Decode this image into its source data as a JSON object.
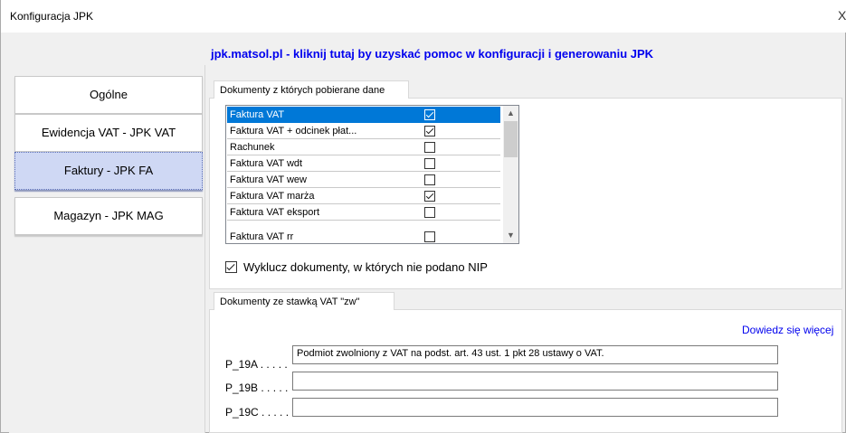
{
  "window": {
    "title": "Konfiguracja JPK",
    "close_glyph": "X"
  },
  "help_link": "jpk.matsol.pl - kliknij tutaj by uzyskać pomoc w konfiguracji i generowaniu JPK",
  "nav": {
    "items": [
      {
        "label": "Ogólne",
        "active": false
      },
      {
        "label": "Ewidencja VAT - JPK VAT",
        "active": false
      },
      {
        "label": "Faktury - JPK FA",
        "active": true
      },
      {
        "label": "Magazyn - JPK MAG",
        "active": false
      }
    ]
  },
  "documents_group": {
    "tab_label": "Dokumenty z których pobierane dane",
    "rows": [
      {
        "label": "Faktura VAT",
        "checked": true,
        "selected": true
      },
      {
        "label": "Faktura VAT + odcinek płat...",
        "checked": true,
        "selected": false
      },
      {
        "label": "Rachunek",
        "checked": false,
        "selected": false
      },
      {
        "label": "Faktura VAT  wdt",
        "checked": false,
        "selected": false
      },
      {
        "label": "Faktura VAT  wew",
        "checked": false,
        "selected": false
      },
      {
        "label": "Faktura VAT marża",
        "checked": true,
        "selected": false
      },
      {
        "label": "Faktura VAT eksport",
        "checked": false,
        "selected": false
      },
      {
        "label": "Faktura VAT rr",
        "checked": false,
        "selected": false
      }
    ],
    "scroll_up_icon": "scroll-up-arrow",
    "scroll_down_icon": "scroll-down-arrow",
    "exclude_checked": true,
    "exclude_label": "Wyklucz dokumenty, w których nie podano NIP"
  },
  "zw_group": {
    "tab_label": "Dokumenty ze stawką VAT \"zw\"",
    "more_link": "Dowiedz się więcej",
    "fields": [
      {
        "label": "P_19A . . . . .",
        "value": "Podmiot zwolniony z VAT na podst. art. 43 ust. 1 pkt 28 ustawy o VAT."
      },
      {
        "label": "P_19B . . . . .",
        "value": ""
      },
      {
        "label": "P_19C . . . . .",
        "value": ""
      }
    ]
  },
  "colors": {
    "accent_selection": "#0078d7",
    "link": "#0000ee",
    "active_nav": "#cfd8f4"
  }
}
